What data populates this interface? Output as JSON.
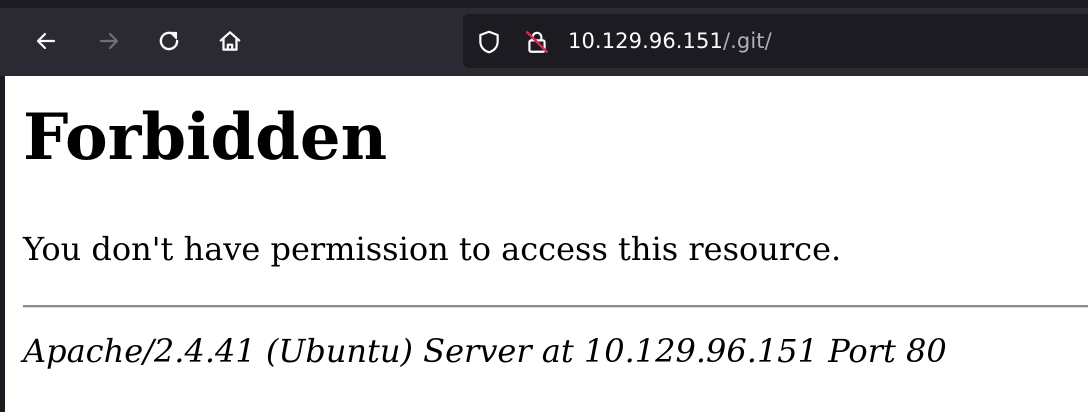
{
  "browser": {
    "nav": {
      "back_icon": "arrow-left-icon",
      "forward_icon": "arrow-right-icon",
      "reload_icon": "reload-icon",
      "home_icon": "home-icon"
    },
    "urlbar": {
      "host": "10.129.96.151",
      "path": "/.git/",
      "tracking_icon": "shield-icon",
      "security_icon": "insecure-lock-icon"
    },
    "colors": {
      "toolbar": "#2b2a33",
      "urlbar": "#1c1b22",
      "icon": "#fbfbfe",
      "disabled_icon": "#6f6e75",
      "insecure_slash": "#e22850"
    }
  },
  "page": {
    "heading": "Forbidden",
    "message": "You don't have permission to access this resource.",
    "server_signature": "Apache/2.4.41 (Ubuntu) Server at 10.129.96.151 Port 80"
  }
}
